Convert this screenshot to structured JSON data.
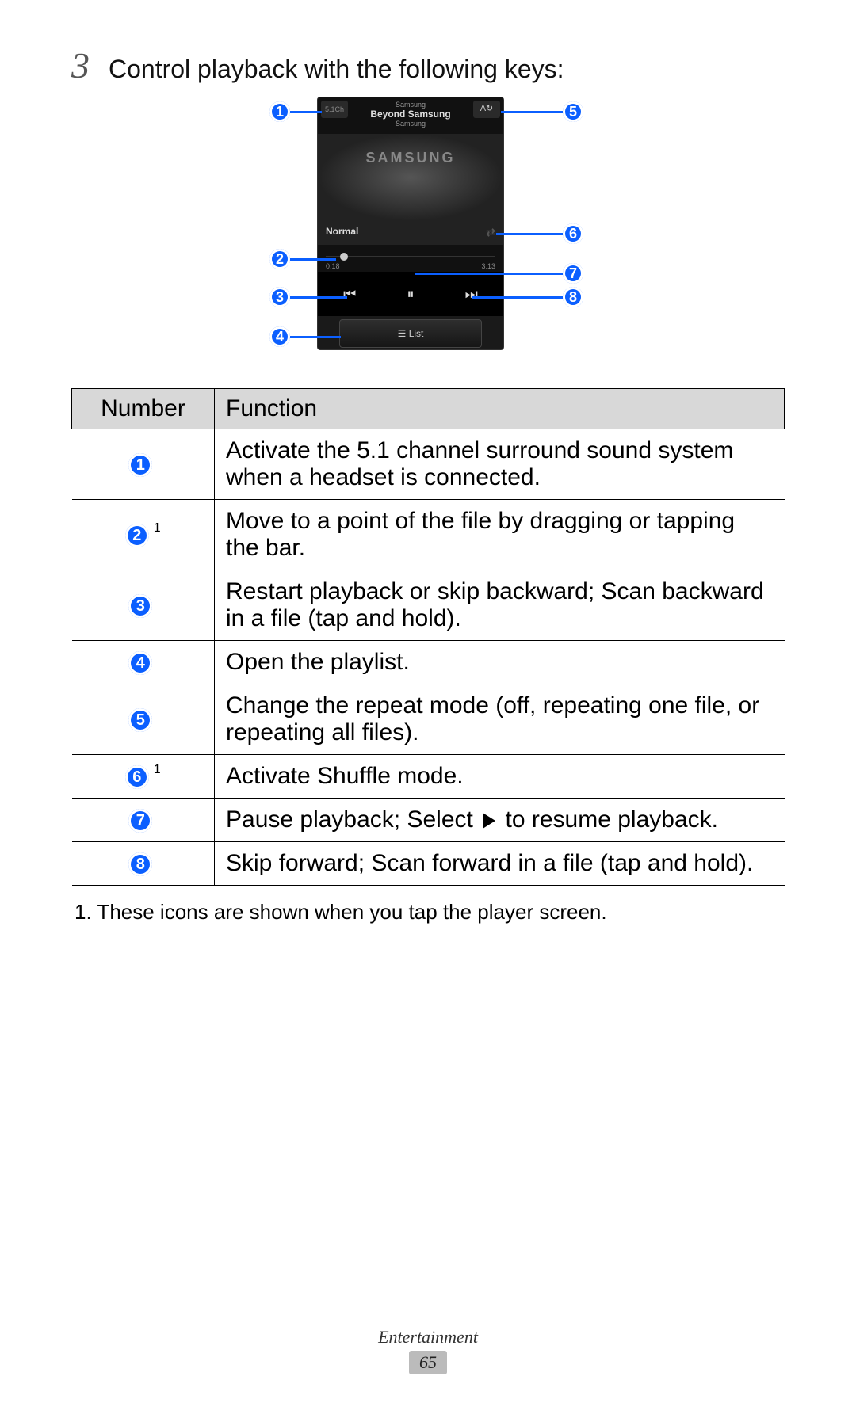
{
  "step": {
    "number": "3",
    "text": "Control playback with the following keys:"
  },
  "phone": {
    "header_top": "Samsung",
    "header_title": "Beyond Samsung",
    "header_sub": "Samsung",
    "badge_51": "5.1Ch",
    "badge_repeat": "A↻",
    "art_brand": "SAMSUNG",
    "normal_label": "Normal",
    "shuffle_glyph": "⇄",
    "time_left": "0:18",
    "time_right": "3:13",
    "prev_glyph": "⏮",
    "pause_glyph": "⏸",
    "next_glyph": "⏭",
    "list_label": "List"
  },
  "callouts": {
    "c1": "1",
    "c2": "2",
    "c3": "3",
    "c4": "4",
    "c5": "5",
    "c6": "6",
    "c7": "7",
    "c8": "8"
  },
  "table": {
    "head_number": "Number",
    "head_function": "Function",
    "rows": [
      {
        "n": "1",
        "sup": "",
        "fn_a": "Activate the 5.1 channel surround sound system when a headset is connected.",
        "fn_b": ""
      },
      {
        "n": "2",
        "sup": "1",
        "fn_a": "Move to a point of the file by dragging or tapping the bar.",
        "fn_b": ""
      },
      {
        "n": "3",
        "sup": "",
        "fn_a": "Restart playback or skip backward; Scan backward in a file (tap and hold).",
        "fn_b": ""
      },
      {
        "n": "4",
        "sup": "",
        "fn_a": "Open the playlist.",
        "fn_b": ""
      },
      {
        "n": "5",
        "sup": "",
        "fn_a": "Change the repeat mode (off, repeating one file, or repeating all files).",
        "fn_b": ""
      },
      {
        "n": "6",
        "sup": "1",
        "fn_a": "Activate Shuffle mode.",
        "fn_b": ""
      },
      {
        "n": "7",
        "sup": "",
        "fn_a": "Pause playback; Select ",
        "fn_b": " to resume playback."
      },
      {
        "n": "8",
        "sup": "",
        "fn_a": "Skip forward; Scan forward in a file (tap and hold).",
        "fn_b": ""
      }
    ]
  },
  "footnote": "1.  These icons are shown when you tap the player screen.",
  "footer": {
    "section": "Entertainment",
    "page": "65"
  }
}
